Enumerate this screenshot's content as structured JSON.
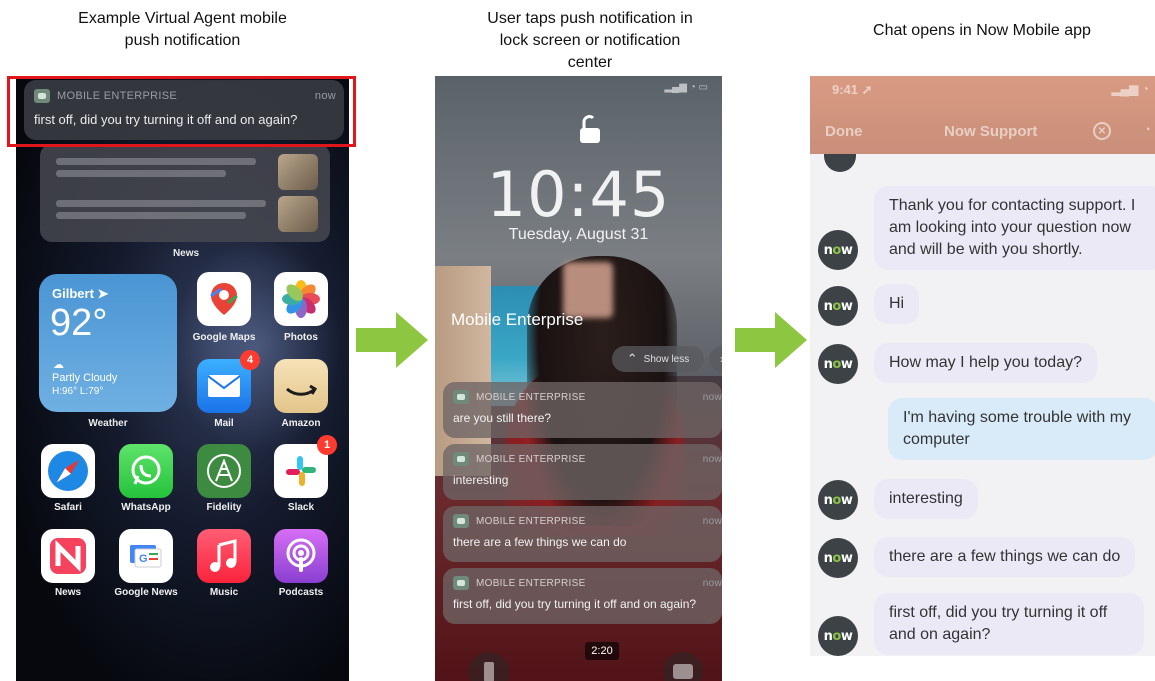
{
  "captions": {
    "step1": [
      "Example Virtual Agent mobile",
      "push notification"
    ],
    "step2": [
      "User taps push notification in",
      "lock screen or notification",
      "center"
    ],
    "step3": [
      "Chat opens in Now Mobile app"
    ]
  },
  "colors": {
    "arrow": "#8dc640",
    "highlight_box": "#e1151c"
  },
  "home_screen": {
    "notification": {
      "app": "MOBILE ENTERPRISE",
      "time": "now",
      "message": "first off, did you try turning it off and on again?"
    },
    "news_label": "News",
    "weather": {
      "city": "Gilbert",
      "temp": "92°",
      "condition": "Partly Cloudy",
      "hilo": "H:96° L:79°",
      "label": "Weather"
    },
    "apps": [
      {
        "label": "Google Maps",
        "icon": "google-maps-icon"
      },
      {
        "label": "Photos",
        "icon": "photos-icon"
      },
      {
        "label": "Mail",
        "icon": "mail-icon",
        "badge": "4"
      },
      {
        "label": "Amazon",
        "icon": "amazon-icon"
      },
      {
        "label": "Safari",
        "icon": "safari-icon"
      },
      {
        "label": "WhatsApp",
        "icon": "whatsapp-icon"
      },
      {
        "label": "Fidelity",
        "icon": "fidelity-icon"
      },
      {
        "label": "Slack",
        "icon": "slack-icon",
        "badge": "1"
      },
      {
        "label": "News",
        "icon": "news-icon"
      },
      {
        "label": "Google News",
        "icon": "google-news-icon"
      },
      {
        "label": "Music",
        "icon": "music-icon"
      },
      {
        "label": "Podcasts",
        "icon": "podcasts-icon"
      }
    ]
  },
  "lock_screen": {
    "time": "10:45",
    "date": "Tuesday, August 31",
    "group_title": "Mobile Enterprise",
    "show_less": "Show less",
    "notifications": [
      {
        "app": "MOBILE ENTERPRISE",
        "time": "now",
        "message": "are you still there?"
      },
      {
        "app": "MOBILE ENTERPRISE",
        "time": "now",
        "message": "interesting"
      },
      {
        "app": "MOBILE ENTERPRISE",
        "time": "now",
        "message": "there are a few things we can do"
      },
      {
        "app": "MOBILE ENTERPRISE",
        "time": "now",
        "message": "first off, did you try turning it off and on again?"
      }
    ],
    "video_timer": "2:20"
  },
  "chat": {
    "status_time": "9:41",
    "done_label": "Done",
    "title": "Now Support",
    "avatar_text": "now",
    "messages": [
      {
        "from": "agent",
        "text": "Thank you for contacting support. I am looking into your question now and will be with you shortly."
      },
      {
        "from": "agent",
        "text": "Hi"
      },
      {
        "from": "agent",
        "text": "How may I help you today?"
      },
      {
        "from": "user",
        "text": "I'm having some trouble with my computer"
      },
      {
        "from": "agent",
        "text": "interesting"
      },
      {
        "from": "agent",
        "text": "there are a few things we can do"
      },
      {
        "from": "agent",
        "text": "first off, did you try turning it off and on again?"
      }
    ]
  }
}
